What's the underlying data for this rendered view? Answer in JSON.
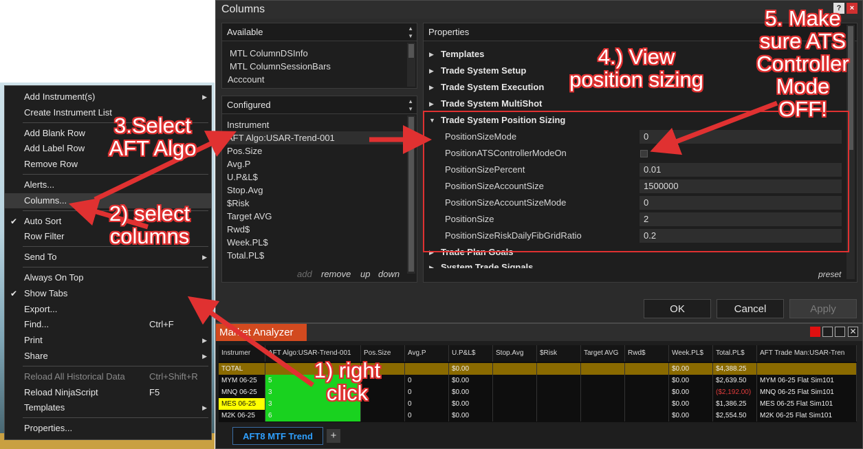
{
  "context_menu": {
    "items": [
      {
        "label": "Add Instrument(s)",
        "submenu": true
      },
      {
        "label": "Create Instrument List"
      },
      {
        "label": "Add Blank Row"
      },
      {
        "label": "Add Label Row"
      },
      {
        "label": "Remove Row"
      },
      {
        "label": "Alerts..."
      },
      {
        "label": "Columns..."
      },
      {
        "label": "Auto Sort",
        "checked": true
      },
      {
        "label": "Row Filter"
      },
      {
        "label": "Send To",
        "submenu": true
      },
      {
        "label": "Always On Top"
      },
      {
        "label": "Show Tabs",
        "checked": true
      },
      {
        "label": "Export..."
      },
      {
        "label": "Find...",
        "shortcut": "Ctrl+F"
      },
      {
        "label": "Print",
        "submenu": true
      },
      {
        "label": "Share",
        "submenu": true
      },
      {
        "label": "Reload All Historical Data",
        "shortcut": "Ctrl+Shift+R",
        "disabled": true
      },
      {
        "label": "Reload NinjaScript",
        "shortcut": "F5"
      },
      {
        "label": "Templates",
        "submenu": true
      },
      {
        "label": "Properties..."
      }
    ]
  },
  "columns_dialog": {
    "title": "Columns",
    "help": "?",
    "close": "×",
    "available": {
      "header": "Available",
      "items": [
        "MTL ColumnDSInfo",
        "MTL ColumnSessionBars",
        "Acccount"
      ]
    },
    "configured": {
      "header": "Configured",
      "items": [
        "Instrument",
        "AFT Algo:USAR-Trend-001",
        "Pos.Size",
        "Avg.P",
        "U.P&L$",
        "Stop.Avg",
        "$Risk",
        "Target AVG",
        "Rwd$",
        "Week.PL$",
        "Total.PL$"
      ],
      "actions": [
        "add",
        "remove",
        "up",
        "down"
      ]
    },
    "properties": {
      "header": "Properties",
      "groups_top": [
        "Templates",
        "Trade System Setup",
        "Trade System Execution",
        "Trade System MultiShot"
      ],
      "expanded_group": "Trade System Position Sizing",
      "rows": [
        {
          "name": "PositionSizeMode",
          "value": "0"
        },
        {
          "name": "PositionATSControllerModeOn",
          "value": ""
        },
        {
          "name": "PositionSizePercent",
          "value": "0.01"
        },
        {
          "name": "PositionSizeAccountSize",
          "value": "1500000"
        },
        {
          "name": "PositionSizeAccountSizeMode",
          "value": "0"
        },
        {
          "name": "PositionSize",
          "value": "2"
        },
        {
          "name": "PositionSizeRiskDailyFibGridRatio",
          "value": "0.2"
        }
      ],
      "groups_bottom": [
        "Trade Plan Goals",
        "System Trade Signals"
      ],
      "preset": "preset"
    },
    "buttons": {
      "ok": "OK",
      "cancel": "Cancel",
      "apply": "Apply"
    }
  },
  "market_analyzer": {
    "title": "Market Analyzer",
    "columns": [
      "Instrumer",
      "AFT Algo:USAR-Trend-001",
      "Pos.Size",
      "Avg.P",
      "U.P&L$",
      "Stop.Avg",
      "$Risk",
      "Target AVG",
      "Rwd$",
      "Week.PL$",
      "Total.PL$",
      "AFT Trade Man:USAR-Tren"
    ],
    "rows": [
      [
        "TOTAL",
        "",
        "",
        "",
        "$0.00",
        "",
        "",
        "",
        "",
        "$0.00",
        "$4,388.25",
        ""
      ],
      [
        "MYM 06-25",
        "5",
        "",
        "0",
        "$0.00",
        "",
        "",
        "",
        "",
        "$0.00",
        "$2,639.50",
        "MYM 06-25 Flat Sim101"
      ],
      [
        "MNQ 06-25",
        "3",
        "",
        "0",
        "$0.00",
        "",
        "",
        "",
        "",
        "$0.00",
        "($2,192.00)",
        "MNQ 06-25 Flat Sim101"
      ],
      [
        "MES 06-25",
        "3",
        "",
        "0",
        "$0.00",
        "",
        "",
        "",
        "",
        "$0.00",
        "$1,386.25",
        "MES 06-25 Flat Sim101"
      ],
      [
        "M2K 06-25",
        "6",
        "",
        "0",
        "$0.00",
        "",
        "",
        "",
        "",
        "$0.00",
        "$2,554.50",
        "M2K 06-25 Flat Sim101"
      ]
    ],
    "workspace_tab": "AFT8 MTF Trend",
    "add_tab": "+"
  },
  "annotations": {
    "step1": [
      "1) right",
      "click"
    ],
    "step2": [
      "2) select",
      "columns"
    ],
    "step3": [
      "3.Select",
      "AFT Algo"
    ],
    "step4": [
      "4.) View",
      "position sizing"
    ],
    "step5": [
      "5. Make",
      "sure ATS",
      "Controller",
      "Mode",
      "OFF!"
    ]
  },
  "colors": {
    "accent_red": "#e03131",
    "total_row": "#8a6a00",
    "algo_green": "#19d21f",
    "loss_red": "#e03c3c",
    "highlight_yellow": "#ffff00"
  }
}
